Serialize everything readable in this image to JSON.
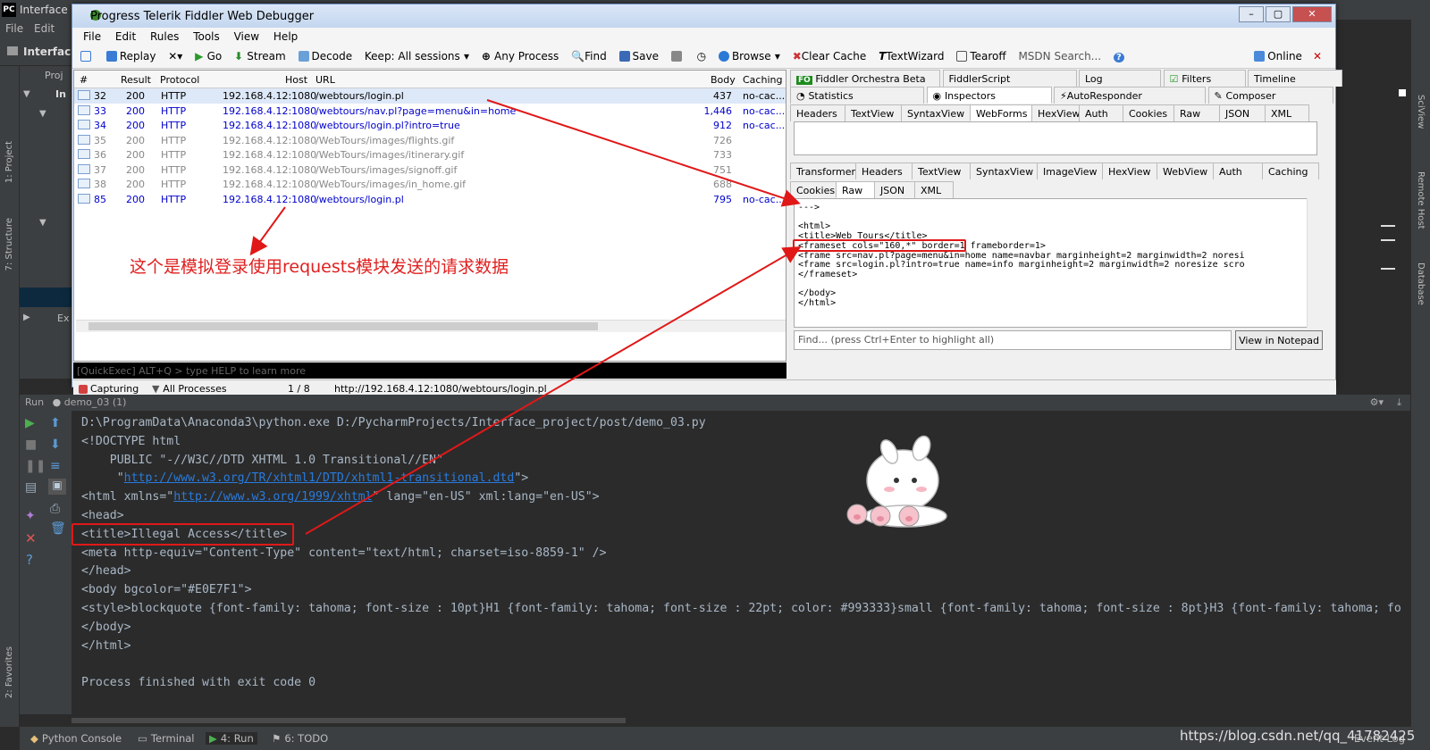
{
  "ide": {
    "title": "Interface",
    "menu": [
      "File",
      "Edit"
    ],
    "project_label": "Interfac",
    "project_tab": "Proj",
    "left_tabs": [
      "1: Project",
      "7: Structure",
      "2: Favorites"
    ],
    "right_tabs": [
      "SciView",
      "Remote Host",
      "Database"
    ],
    "tree_items": [
      "In",
      "Ex"
    ]
  },
  "fiddler": {
    "title": "Progress Telerik Fiddler Web Debugger",
    "menu": [
      "File",
      "Edit",
      "Rules",
      "Tools",
      "View",
      "Help"
    ],
    "toolbar": [
      "Replay",
      "Go",
      "Stream",
      "Decode",
      "Keep: All sessions",
      "Any Process",
      "Find",
      "Save",
      "Browse",
      "Clear Cache",
      "TextWizard",
      "Tearoff",
      "MSDN Search...",
      "Online"
    ],
    "columns": {
      "num": "#",
      "result": "Result",
      "protocol": "Protocol",
      "host": "Host",
      "url": "URL",
      "body": "Body",
      "caching": "Caching"
    },
    "sessions": [
      {
        "id": "32",
        "result": "200",
        "protocol": "HTTP",
        "host": "192.168.4.12:1080",
        "url": "/webtours/login.pl",
        "body": "437",
        "caching": "no-cac...",
        "style": "sel"
      },
      {
        "id": "33",
        "result": "200",
        "protocol": "HTTP",
        "host": "192.168.4.12:1080",
        "url": "/webtours/nav.pl?page=menu&in=home",
        "body": "1,446",
        "caching": "no-cac...",
        "style": "blue"
      },
      {
        "id": "34",
        "result": "200",
        "protocol": "HTTP",
        "host": "192.168.4.12:1080",
        "url": "/webtours/login.pl?intro=true",
        "body": "912",
        "caching": "no-cac...",
        "style": "blue"
      },
      {
        "id": "35",
        "result": "200",
        "protocol": "HTTP",
        "host": "192.168.4.12:1080",
        "url": "/WebTours/images/flights.gif",
        "body": "726",
        "caching": "",
        "style": "grey"
      },
      {
        "id": "36",
        "result": "200",
        "protocol": "HTTP",
        "host": "192.168.4.12:1080",
        "url": "/WebTours/images/itinerary.gif",
        "body": "733",
        "caching": "",
        "style": "grey"
      },
      {
        "id": "37",
        "result": "200",
        "protocol": "HTTP",
        "host": "192.168.4.12:1080",
        "url": "/WebTours/images/signoff.gif",
        "body": "751",
        "caching": "",
        "style": "grey"
      },
      {
        "id": "38",
        "result": "200",
        "protocol": "HTTP",
        "host": "192.168.4.12:1080",
        "url": "/WebTours/images/in_home.gif",
        "body": "688",
        "caching": "",
        "style": "grey"
      },
      {
        "id": "85",
        "result": "200",
        "protocol": "HTTP",
        "host": "192.168.4.12:1080",
        "url": "/webtours/login.pl",
        "body": "795",
        "caching": "no-cac...",
        "style": "blue"
      }
    ],
    "quickexec": "[QuickExec] ALT+Q > type HELP to learn more",
    "status": {
      "capturing": "Capturing",
      "processes": "All Processes",
      "count": "1 / 8",
      "url": "http://192.168.4.12:1080/webtours/login.pl"
    },
    "inspector_tabs_1": [
      "Fiddler Orchestra Beta",
      "FiddlerScript",
      "Log",
      "Filters",
      "Timeline"
    ],
    "inspector_tabs_2": [
      "Statistics",
      "Inspectors",
      "AutoResponder",
      "Composer"
    ],
    "request_tabs": [
      "Headers",
      "TextView",
      "SyntaxView",
      "WebForms",
      "HexView",
      "Auth",
      "Cookies",
      "Raw",
      "JSON",
      "XML"
    ],
    "response_tabs_1": [
      "Transformer",
      "Headers",
      "TextView",
      "SyntaxView",
      "ImageView",
      "HexView",
      "WebView",
      "Auth",
      "Caching"
    ],
    "response_tabs_2": [
      "Cookies",
      "Raw",
      "JSON",
      "XML"
    ],
    "raw_lines": [
      "--->",
      "",
      "<html>",
      "<title>Web Tours</title>",
      "<frameset cols=\"160,*\" border=1 frameborder=1>",
      "<frame src=nav.pl?page=menu&in=home name=navbar marginheight=2 marginwidth=2 noresi",
      "<frame src=login.pl?intro=true name=info marginheight=2 marginwidth=2 noresize scro",
      "</frameset>",
      "",
      "</body>",
      "</html>"
    ],
    "find_placeholder": "Find... (press Ctrl+Enter to highlight all)",
    "view_notepad": "View in Notepad"
  },
  "annotation": "这个是模拟登录使用requests模块发送的请求数据",
  "run": {
    "header": "Run",
    "config": "demo_03 (1)",
    "lines": [
      {
        "t": "D:\\ProgramData\\Anaconda3\\python.exe D:/PycharmProjects/Interface_project/post/demo_03.py"
      },
      {
        "t": "<!DOCTYPE html"
      },
      {
        "t": "    PUBLIC \"-//W3C//DTD XHTML 1.0 Transitional//EN\""
      },
      {
        "pre": "     \"",
        "link": "http://www.w3.org/TR/xhtml1/DTD/xhtml1-transitional.dtd",
        "post": "\">"
      },
      {
        "pre": "<html xmlns=\"",
        "link": "http://www.w3.org/1999/xhtml",
        "post": "\" lang=\"en-US\" xml:lang=\"en-US\">"
      },
      {
        "t": "<head>"
      },
      {
        "t": "<title>Illegal Access</title>"
      },
      {
        "t": "<meta http-equiv=\"Content-Type\" content=\"text/html; charset=iso-8859-1\" />"
      },
      {
        "t": "</head>"
      },
      {
        "t": "<body bgcolor=\"#E0E7F1\">"
      },
      {
        "t": "<style>blockquote {font-family: tahoma; font-size : 10pt}H1 {font-family: tahoma; font-size : 22pt; color: #993333}small {font-family: tahoma; font-size : 8pt}H3 {font-family: tahoma; fo"
      },
      {
        "t": "</body>"
      },
      {
        "t": "</html>"
      },
      {
        "t": ""
      },
      {
        "t": "Process finished with exit code 0"
      }
    ]
  },
  "bottom": {
    "python_console": "Python Console",
    "terminal": "Terminal",
    "run": "4: Run",
    "todo": "6: TODO",
    "event_log": "Event Log"
  },
  "watermark": "https://blog.csdn.net/qq_41782425",
  "colors": {
    "accent_red": "#e01818",
    "link": "#287bde",
    "console_bg": "#2b2b2b",
    "ide_panel": "#3c3f41"
  }
}
